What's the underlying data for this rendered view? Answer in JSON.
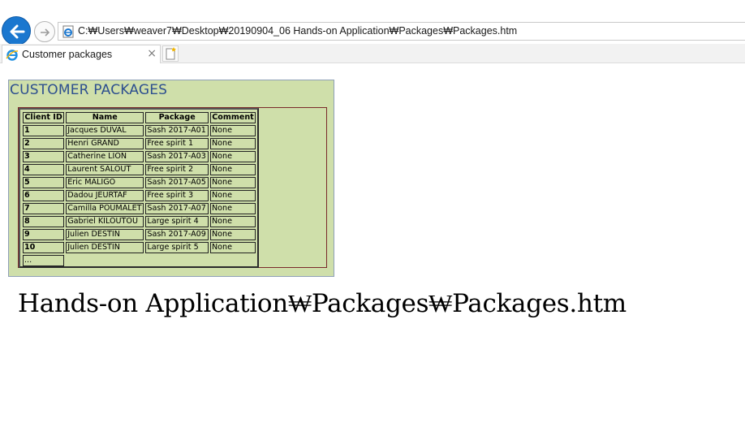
{
  "browser": {
    "address": "C:₩Users₩weaver7₩Desktop₩20190904_06 Hands-on Application₩Packages₩Packages.htm",
    "tab_title": "Customer packages",
    "tab_close": "×",
    "accent_color": "#1a77cf"
  },
  "page": {
    "title": "CUSTOMER PACKAGES",
    "table": {
      "headers": [
        "Client ID",
        "Name",
        "Package",
        "Comment"
      ],
      "rows": [
        [
          "1",
          "Jacques DUVAL",
          "Sash 2017-A01",
          "None"
        ],
        [
          "2",
          "Henri GRAND",
          "Free spirit 1",
          "None"
        ],
        [
          "3",
          "Catherine LION",
          "Sash 2017-A03",
          "None"
        ],
        [
          "4",
          "Laurent SALOUT",
          "Free spirit 2",
          "None"
        ],
        [
          "5",
          "Eric MALIGO",
          "Sash 2017-A05",
          "None"
        ],
        [
          "6",
          "Dadou JEURTAF",
          "Free spirit 3",
          "None"
        ],
        [
          "7",
          "Camilla POUMALET",
          "Sash 2017-A07",
          "None"
        ],
        [
          "8",
          "Gabriel KILOUTOU",
          "Large spirit 4",
          "None"
        ],
        [
          "9",
          "Julien DESTIN",
          "Sash 2017-A09",
          "None"
        ],
        [
          "10",
          "Julien DESTIN",
          "Large spirit 5",
          "None"
        ]
      ],
      "ellipsis": "..."
    },
    "path_caption": "Hands-on Application₩Packages₩Packages.htm",
    "panel_color": "#cfdfaa"
  }
}
